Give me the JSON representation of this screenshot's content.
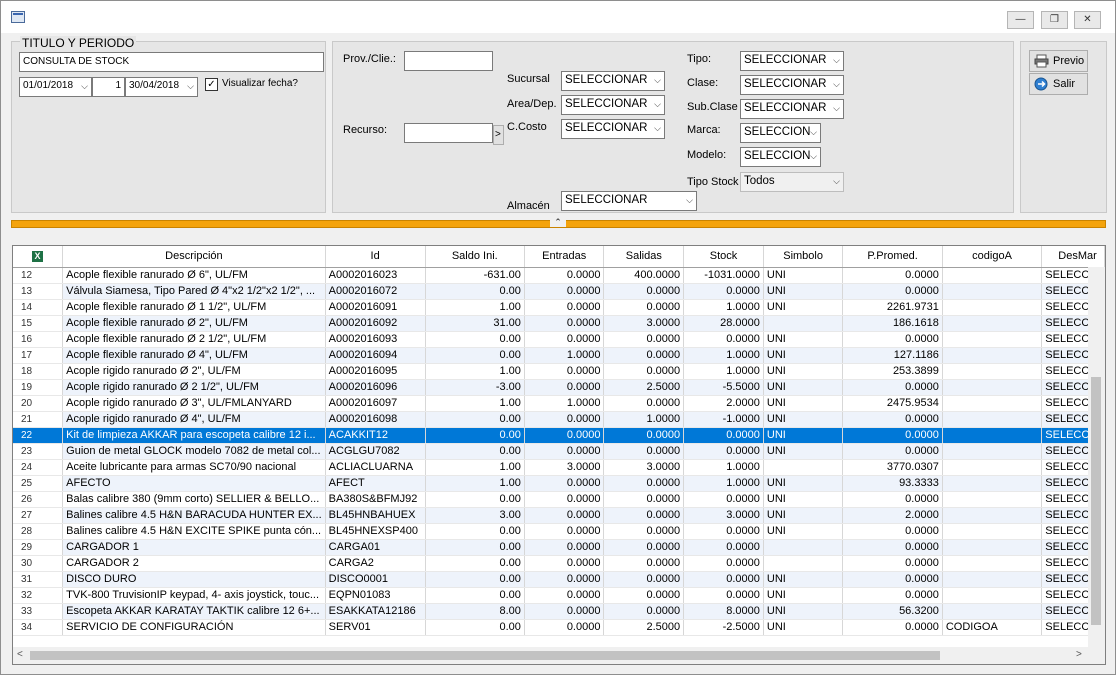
{
  "window": {
    "min_glyph": "—",
    "max_glyph": "❐",
    "close_glyph": "✕"
  },
  "filters": {
    "group_title": "TITULO Y PERIODO",
    "report_title": "CONSULTA DE STOCK",
    "date_from": "01/01/2018",
    "date_mid": "1",
    "date_to": "30/04/2018",
    "show_date_label": "Visualizar fecha?",
    "show_date_checked": "✓",
    "prov_label": "Prov./Clie.:",
    "prov_value": "",
    "recurso_label": "Recurso:",
    "recurso_value": "",
    "recurso_btn": ">",
    "sucursal_label": "Sucursal",
    "sucursal_value": "SELECCIONAR",
    "area_label": "Area/Dep.",
    "area_value": "SELECCIONAR",
    "ccosto_label": "C.Costo",
    "ccosto_value": "SELECCIONAR",
    "almacen_label": "Almacén",
    "almacen_value": "SELECCIONAR",
    "tipo_label": "Tipo:",
    "tipo_value": "SELECCIONAR",
    "clase_label": "Clase:",
    "clase_value": "SELECCIONAR",
    "subclase_label": "Sub.Clase",
    "subclase_value": "SELECCIONAR",
    "marca_label": "Marca:",
    "marca_value": "SELECCION",
    "modelo_label": "Modelo:",
    "modelo_value": "SELECCION",
    "tipostock_label": "Tipo Stock",
    "tipostock_value": "Todos"
  },
  "actions": {
    "previo_label": "Previo",
    "salir_label": "Salir"
  },
  "table": {
    "excel_icon": "X",
    "columns": [
      "Descripción",
      "Id",
      "Saldo Ini.",
      "Entradas",
      "Salidas",
      "Stock",
      "Simbolo",
      "P.Promed.",
      "codigoA",
      "DesMar"
    ],
    "rows": [
      {
        "n": "12",
        "desc": "Acople flexible ranurado Ø 6\", UL/FM",
        "id": "A0002016023",
        "saldo": "-631.00",
        "ent": "0.0000",
        "sal": "400.0000",
        "stock": "-1031.0000",
        "sim": "UNI",
        "pp": "0.0000",
        "cod": "",
        "des": "SELECCIO"
      },
      {
        "n": "13",
        "desc": "Válvula Siamesa, Tipo Pared Ø 4\"x2 1/2\"x2 1/2\", ...",
        "id": "A0002016072",
        "saldo": "0.00",
        "ent": "0.0000",
        "sal": "0.0000",
        "stock": "0.0000",
        "sim": "UNI",
        "pp": "0.0000",
        "cod": "",
        "des": "SELECCIO"
      },
      {
        "n": "14",
        "desc": "Acople flexible ranurado Ø 1 1/2\", UL/FM",
        "id": "A0002016091",
        "saldo": "1.00",
        "ent": "0.0000",
        "sal": "0.0000",
        "stock": "1.0000",
        "sim": "UNI",
        "pp": "2261.9731",
        "cod": "",
        "des": "SELECCIO"
      },
      {
        "n": "15",
        "desc": "Acople flexible ranurado Ø 2\", UL/FM",
        "id": "A0002016092",
        "saldo": "31.00",
        "ent": "0.0000",
        "sal": "3.0000",
        "stock": "28.0000",
        "sim": "",
        "pp": "186.1618",
        "cod": "",
        "des": "SELECCIO"
      },
      {
        "n": "16",
        "desc": "Acople flexible ranurado Ø 2 1/2\", UL/FM",
        "id": "A0002016093",
        "saldo": "0.00",
        "ent": "0.0000",
        "sal": "0.0000",
        "stock": "0.0000",
        "sim": "UNI",
        "pp": "0.0000",
        "cod": "",
        "des": "SELECCIO"
      },
      {
        "n": "17",
        "desc": "Acople flexible ranurado Ø 4\", UL/FM",
        "id": "A0002016094",
        "saldo": "0.00",
        "ent": "1.0000",
        "sal": "0.0000",
        "stock": "1.0000",
        "sim": "UNI",
        "pp": "127.1186",
        "cod": "",
        "des": "SELECCIO"
      },
      {
        "n": "18",
        "desc": "Acople rigido ranurado Ø 2\", UL/FM",
        "id": "A0002016095",
        "saldo": "1.00",
        "ent": "0.0000",
        "sal": "0.0000",
        "stock": "1.0000",
        "sim": "UNI",
        "pp": "253.3899",
        "cod": "",
        "des": "SELECCIO"
      },
      {
        "n": "19",
        "desc": "Acople rigido ranurado Ø 2 1/2\", UL/FM",
        "id": "A0002016096",
        "saldo": "-3.00",
        "ent": "0.0000",
        "sal": "2.5000",
        "stock": "-5.5000",
        "sim": "UNI",
        "pp": "0.0000",
        "cod": "",
        "des": "SELECCIO"
      },
      {
        "n": "20",
        "desc": "Acople rigido ranurado Ø 3\", UL/FMLANYARD",
        "id": "A0002016097",
        "saldo": "1.00",
        "ent": "1.0000",
        "sal": "0.0000",
        "stock": "2.0000",
        "sim": "UNI",
        "pp": "2475.9534",
        "cod": "",
        "des": "SELECCIO"
      },
      {
        "n": "21",
        "desc": "Acople rigido ranurado Ø 4\", UL/FM",
        "id": "A0002016098",
        "saldo": "0.00",
        "ent": "0.0000",
        "sal": "1.0000",
        "stock": "-1.0000",
        "sim": "UNI",
        "pp": "0.0000",
        "cod": "",
        "des": "SELECCIO"
      },
      {
        "n": "22",
        "desc": "Kit de limpieza AKKAR para escopeta calibre 12 i...",
        "id": "ACAKKIT12",
        "saldo": "0.00",
        "ent": "0.0000",
        "sal": "0.0000",
        "stock": "0.0000",
        "sim": "UNI",
        "pp": "0.0000",
        "cod": "",
        "des": "SELECCIO",
        "sel": true
      },
      {
        "n": "23",
        "desc": "Guion de metal GLOCK modelo 7082 de metal col...",
        "id": "ACGLGU7082",
        "saldo": "0.00",
        "ent": "0.0000",
        "sal": "0.0000",
        "stock": "0.0000",
        "sim": "UNI",
        "pp": "0.0000",
        "cod": "",
        "des": "SELECCIO"
      },
      {
        "n": "24",
        "desc": "Aceite lubricante para armas SC70/90 nacional",
        "id": "ACLIACLUARNA",
        "saldo": "1.00",
        "ent": "3.0000",
        "sal": "3.0000",
        "stock": "1.0000",
        "sim": "",
        "pp": "3770.0307",
        "cod": "",
        "des": "SELECCIO"
      },
      {
        "n": "25",
        "desc": "AFECTO",
        "id": "AFECT",
        "saldo": "1.00",
        "ent": "0.0000",
        "sal": "0.0000",
        "stock": "1.0000",
        "sim": "UNI",
        "pp": "93.3333",
        "cod": "",
        "des": "SELECCIO"
      },
      {
        "n": "26",
        "desc": "Balas calibre 380 (9mm corto) SELLIER & BELLO...",
        "id": "BA380S&BFMJ92",
        "saldo": "0.00",
        "ent": "0.0000",
        "sal": "0.0000",
        "stock": "0.0000",
        "sim": "UNI",
        "pp": "0.0000",
        "cod": "",
        "des": "SELECCIO"
      },
      {
        "n": "27",
        "desc": "Balines calibre 4.5 H&N BARACUDA HUNTER EX...",
        "id": "BL45HNBAHUEX",
        "saldo": "3.00",
        "ent": "0.0000",
        "sal": "0.0000",
        "stock": "3.0000",
        "sim": "UNI",
        "pp": "2.0000",
        "cod": "",
        "des": "SELECCIO"
      },
      {
        "n": "28",
        "desc": "Balines calibre 4.5 H&N EXCITE SPIKE punta cón...",
        "id": "BL45HNEXSP400",
        "saldo": "0.00",
        "ent": "0.0000",
        "sal": "0.0000",
        "stock": "0.0000",
        "sim": "UNI",
        "pp": "0.0000",
        "cod": "",
        "des": "SELECCIO"
      },
      {
        "n": "29",
        "desc": "CARGADOR 1",
        "id": "CARGA01",
        "saldo": "0.00",
        "ent": "0.0000",
        "sal": "0.0000",
        "stock": "0.0000",
        "sim": "",
        "pp": "0.0000",
        "cod": "",
        "des": "SELECCIO"
      },
      {
        "n": "30",
        "desc": "CARGADOR 2",
        "id": "CARGA2",
        "saldo": "0.00",
        "ent": "0.0000",
        "sal": "0.0000",
        "stock": "0.0000",
        "sim": "",
        "pp": "0.0000",
        "cod": "",
        "des": "SELECCIO"
      },
      {
        "n": "31",
        "desc": "DISCO DURO",
        "id": "DISCO0001",
        "saldo": "0.00",
        "ent": "0.0000",
        "sal": "0.0000",
        "stock": "0.0000",
        "sim": "UNI",
        "pp": "0.0000",
        "cod": "",
        "des": "SELECCIO"
      },
      {
        "n": "32",
        "desc": "TVK-800  TruvisionIP keypad, 4- axis joystick, touc...",
        "id": "EQPN01083",
        "saldo": "0.00",
        "ent": "0.0000",
        "sal": "0.0000",
        "stock": "0.0000",
        "sim": "UNI",
        "pp": "0.0000",
        "cod": "",
        "des": "SELECCIO"
      },
      {
        "n": "33",
        "desc": "Escopeta AKKAR KARATAY TAKTIK calibre 12 6+...",
        "id": "ESAKKATA12186",
        "saldo": "8.00",
        "ent": "0.0000",
        "sal": "0.0000",
        "stock": "8.0000",
        "sim": "UNI",
        "pp": "56.3200",
        "cod": "",
        "des": "SELECCIO"
      },
      {
        "n": "34",
        "desc": "SERVICIO DE CONFIGURACIÓN",
        "id": "SERV01",
        "saldo": "0.00",
        "ent": "0.0000",
        "sal": "2.5000",
        "stock": "-2.5000",
        "sim": "UNI",
        "pp": "0.0000",
        "cod": "CODIGOA",
        "des": "SELECCIO"
      }
    ]
  },
  "colors": {
    "accent_bar": "#f4a30c",
    "selection": "#0078d7",
    "alt_row": "#eef3fb"
  }
}
